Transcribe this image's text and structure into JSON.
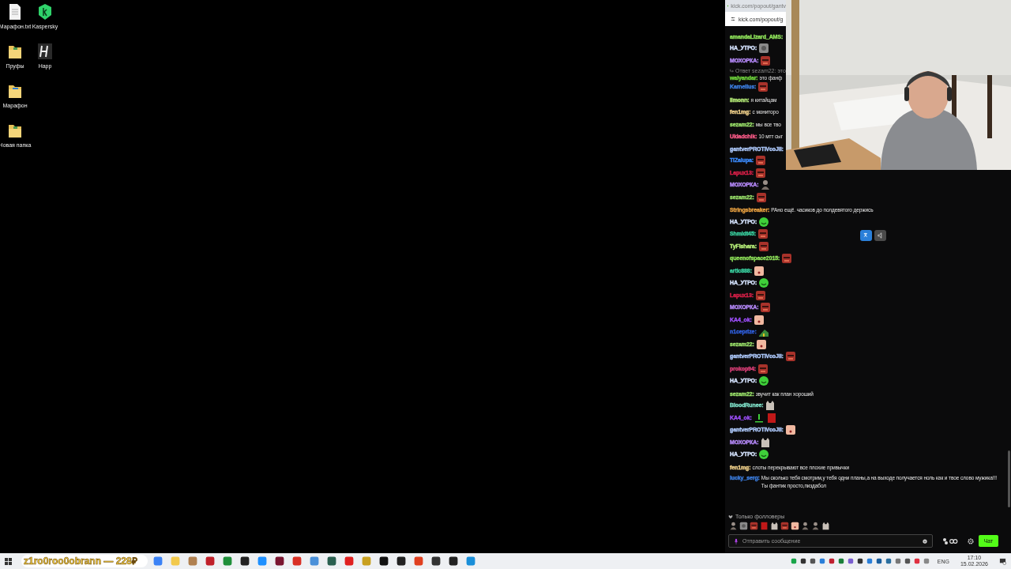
{
  "desktop_icons": [
    {
      "label": "Марафон.txt",
      "kind": "text-file"
    },
    {
      "label": "Пруфы",
      "kind": "folder"
    },
    {
      "label": "Марафон",
      "kind": "doc-folder"
    },
    {
      "label": "Новая папка",
      "kind": "folder"
    },
    {
      "label": "Kaspersky",
      "kind": "kaspersky"
    },
    {
      "label": "Happ",
      "kind": "happ"
    }
  ],
  "browser": {
    "tab_url": "kick.com/popout/gantv",
    "address": "kick.com/popout/g"
  },
  "chat": {
    "messages": [
      {
        "user": "amandaLizard_AMS:",
        "color": "#8fe35a"
      },
      {
        "user": "НА_УТРО:",
        "color": "#d6e4ff",
        "emotes": [
          {
            "kind": "grey"
          }
        ]
      },
      {
        "user": "МОХОРКА:",
        "color": "#b98cff",
        "emotes": [
          {
            "kind": "face-red"
          }
        ]
      },
      {
        "user": "walyandar:",
        "color": "#6fd63c",
        "text": "это фанф",
        "reply": "Ответ sezam22: это"
      },
      {
        "user": "Karnelius:",
        "color": "#3c7ee0",
        "emotes": [
          {
            "kind": "face-red"
          }
        ]
      },
      {
        "user": "limonn:",
        "color": "#b8f07a",
        "text": "я китайцам"
      },
      {
        "user": "fen1mg:",
        "color": "#f0d08a",
        "text": "с мониторо"
      },
      {
        "user": "sezam22:",
        "color": "#9be36b",
        "text": "мы все тво"
      },
      {
        "user": "Ukladchik:",
        "color": "#ff5c8a",
        "text": "10 мтт сыг"
      },
      {
        "user": "gantverPROTIVcoJli:",
        "color": "#b0ccff"
      },
      {
        "user": "TiZalupa:",
        "color": "#3c8cff",
        "emotes": [
          {
            "kind": "face-red"
          }
        ]
      },
      {
        "user": "Lapux13:",
        "color": "#e0204a",
        "emotes": [
          {
            "kind": "face-red"
          }
        ]
      },
      {
        "user": "МОХОРКА:",
        "color": "#b98cff",
        "emotes": [
          {
            "kind": "figure"
          }
        ]
      },
      {
        "user": "sezam22:",
        "color": "#9be36b",
        "emotes": [
          {
            "kind": "face-red"
          }
        ]
      },
      {
        "user": "Stringsbreaker:",
        "color": "#e8a040",
        "text": "РАно ещё. часиков до полдевятого держись"
      },
      {
        "user": "НА_УТРО:",
        "color": "#d6e4ff",
        "emotes": [
          {
            "kind": "smiley"
          }
        ]
      },
      {
        "user": "Shmidt45:",
        "color": "#3ad1a0",
        "emotes": [
          {
            "kind": "face-red"
          }
        ]
      },
      {
        "user": "TyFishara:",
        "color": "#b8f07a",
        "emotes": [
          {
            "kind": "face-red"
          }
        ]
      },
      {
        "user": "queenofspace2015:",
        "color": "#8fe35a",
        "emotes": [
          {
            "kind": "face-red"
          }
        ]
      },
      {
        "user": "artic888:",
        "color": "#3ad1a0",
        "emotes": [
          {
            "kind": "face-pale"
          }
        ]
      },
      {
        "user": "НА_УТРО:",
        "color": "#d6e4ff",
        "emotes": [
          {
            "kind": "smiley"
          }
        ]
      },
      {
        "user": "Lapux13:",
        "color": "#e0204a",
        "emotes": [
          {
            "kind": "face-red"
          }
        ]
      },
      {
        "user": "МОХОРКА:",
        "color": "#b98cff",
        "emotes": [
          {
            "kind": "face-red"
          }
        ]
      },
      {
        "user": "KA4_ok:",
        "color": "#a050ff",
        "emotes": [
          {
            "kind": "face-pale"
          }
        ]
      },
      {
        "user": "n1ceprize:",
        "color": "#3060e0",
        "emotes": [
          {
            "kind": "landscape"
          }
        ]
      },
      {
        "user": "sezam22:",
        "color": "#9be36b",
        "emotes": [
          {
            "kind": "face-pale"
          }
        ]
      },
      {
        "user": "gantverPROTIVcoJli:",
        "color": "#b0ccff",
        "emotes": [
          {
            "kind": "face-red"
          }
        ]
      },
      {
        "user": "prokop94:",
        "color": "#e0407a",
        "emotes": [
          {
            "kind": "face-red"
          }
        ]
      },
      {
        "user": "НА_УТРО:",
        "color": "#d6e4ff",
        "emotes": [
          {
            "kind": "smiley"
          }
        ]
      },
      {
        "user": "sezam22:",
        "color": "#9be36b",
        "text": "звучит как план хороший"
      },
      {
        "user": "BloodRunee:",
        "color": "#7fe0c8",
        "emotes": [
          {
            "kind": "cat"
          }
        ]
      },
      {
        "user": "KA4_ok:",
        "color": "#a050ff",
        "emotes": [
          {
            "kind": "meter"
          },
          {
            "kind": "red-block"
          }
        ]
      },
      {
        "user": "gantverPROTIVcoJli:",
        "color": "#b0ccff",
        "emotes": [
          {
            "kind": "face-pale"
          }
        ]
      },
      {
        "user": "МОХОРКА:",
        "color": "#b98cff",
        "emotes": [
          {
            "kind": "cat"
          }
        ]
      },
      {
        "user": "НА_УТРО:",
        "color": "#d6e4ff",
        "emotes": [
          {
            "kind": "smiley"
          }
        ]
      },
      {
        "user": "fen1mg:",
        "color": "#f0d08a",
        "text": "слоты перекрывают все плохие привычки"
      },
      {
        "user": "lucky_serg:",
        "color": "#3c7ee0",
        "text": "Мы сколько тебя смотрим,у тебя одни планы,а на выходе получается ноль как и твое слово мужика!!!Ты фантик просто,пиздабол"
      }
    ],
    "followers_only": "Только фолловеры",
    "recent_emotes": [
      {
        "kind": "figure"
      },
      {
        "kind": "grey"
      },
      {
        "kind": "face-red"
      },
      {
        "kind": "red-block"
      },
      {
        "kind": "cat"
      },
      {
        "kind": "face-red"
      },
      {
        "kind": "face-pale"
      },
      {
        "kind": "figure"
      },
      {
        "kind": "figure"
      },
      {
        "kind": "cat"
      }
    ],
    "input": {
      "placeholder": "Отправить сообщение"
    },
    "send_button": "Чат"
  },
  "overlay": {
    "donation": "z1ro0roo0obrann — 228₽"
  },
  "taskbar": {
    "language": "ENG",
    "time": "17:10",
    "date": "15.02.2026"
  }
}
